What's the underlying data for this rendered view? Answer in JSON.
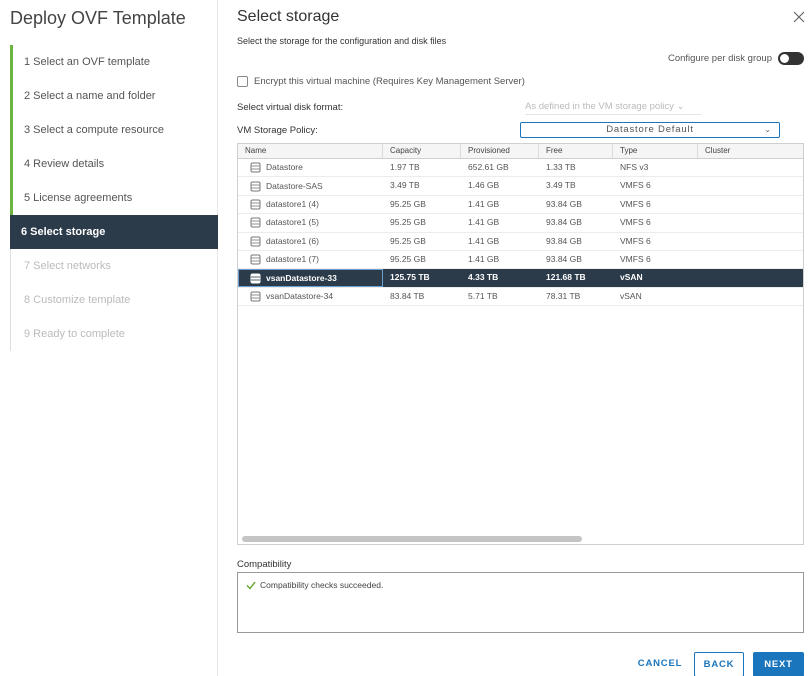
{
  "wizard": {
    "title": "Deploy OVF Template",
    "steps": [
      {
        "label": "1 Select an OVF template",
        "state": "done"
      },
      {
        "label": "2 Select a name and folder",
        "state": "done"
      },
      {
        "label": "3 Select a compute resource",
        "state": "done"
      },
      {
        "label": "4 Review details",
        "state": "done"
      },
      {
        "label": "5 License agreements",
        "state": "done"
      },
      {
        "label": "6 Select storage",
        "state": "active"
      },
      {
        "label": "7 Select networks",
        "state": "disabled"
      },
      {
        "label": "8 Customize template",
        "state": "disabled"
      },
      {
        "label": "9 Ready to complete",
        "state": "disabled"
      }
    ]
  },
  "page": {
    "title": "Select storage",
    "subtitle": "Select the storage for the configuration and disk files",
    "configure_per_disk": "Configure per disk group",
    "encrypt_label": "Encrypt this virtual machine (Requires Key Management Server)",
    "disk_format_label": "Select virtual disk format:",
    "disk_format_value": "As defined in the VM storage policy",
    "policy_label": "VM Storage Policy:",
    "policy_value": "Datastore Default"
  },
  "table": {
    "columns": [
      "Name",
      "Capacity",
      "Provisioned",
      "Free",
      "Type",
      "Cluster"
    ],
    "rows": [
      {
        "name": "Datastore",
        "capacity": "1.97 TB",
        "provisioned": "652.61 GB",
        "free": "1.33 TB",
        "type": "NFS v3",
        "cluster": "",
        "selected": false
      },
      {
        "name": "Datastore-SAS",
        "capacity": "3.49 TB",
        "provisioned": "1.46 GB",
        "free": "3.49 TB",
        "type": "VMFS 6",
        "cluster": "",
        "selected": false
      },
      {
        "name": "datastore1 (4)",
        "capacity": "95.25 GB",
        "provisioned": "1.41 GB",
        "free": "93.84 GB",
        "type": "VMFS 6",
        "cluster": "",
        "selected": false
      },
      {
        "name": "datastore1 (5)",
        "capacity": "95.25 GB",
        "provisioned": "1.41 GB",
        "free": "93.84 GB",
        "type": "VMFS 6",
        "cluster": "",
        "selected": false
      },
      {
        "name": "datastore1 (6)",
        "capacity": "95.25 GB",
        "provisioned": "1.41 GB",
        "free": "93.84 GB",
        "type": "VMFS 6",
        "cluster": "",
        "selected": false
      },
      {
        "name": "datastore1 (7)",
        "capacity": "95.25 GB",
        "provisioned": "1.41 GB",
        "free": "93.84 GB",
        "type": "VMFS 6",
        "cluster": "",
        "selected": false
      },
      {
        "name": "vsanDatastore-33",
        "capacity": "125.75 TB",
        "provisioned": "4.33 TB",
        "free": "121.68 TB",
        "type": "vSAN",
        "cluster": "",
        "selected": true
      },
      {
        "name": "vsanDatastore-34",
        "capacity": "83.84 TB",
        "provisioned": "5.71 TB",
        "free": "78.31 TB",
        "type": "vSAN",
        "cluster": "",
        "selected": false
      }
    ]
  },
  "compatibility": {
    "label": "Compatibility",
    "message": "Compatibility checks succeeded."
  },
  "buttons": {
    "cancel": "CANCEL",
    "back": "BACK",
    "next": "NEXT"
  },
  "icons": {
    "close": "close-icon",
    "datastore": "database-icon",
    "check": "check-icon",
    "chevron": "chevron-down-icon"
  },
  "colors": {
    "accent": "#1a75bc",
    "selected_row": "#2b3b4a",
    "done_step": "#6db33f",
    "success": "#5aa220"
  }
}
